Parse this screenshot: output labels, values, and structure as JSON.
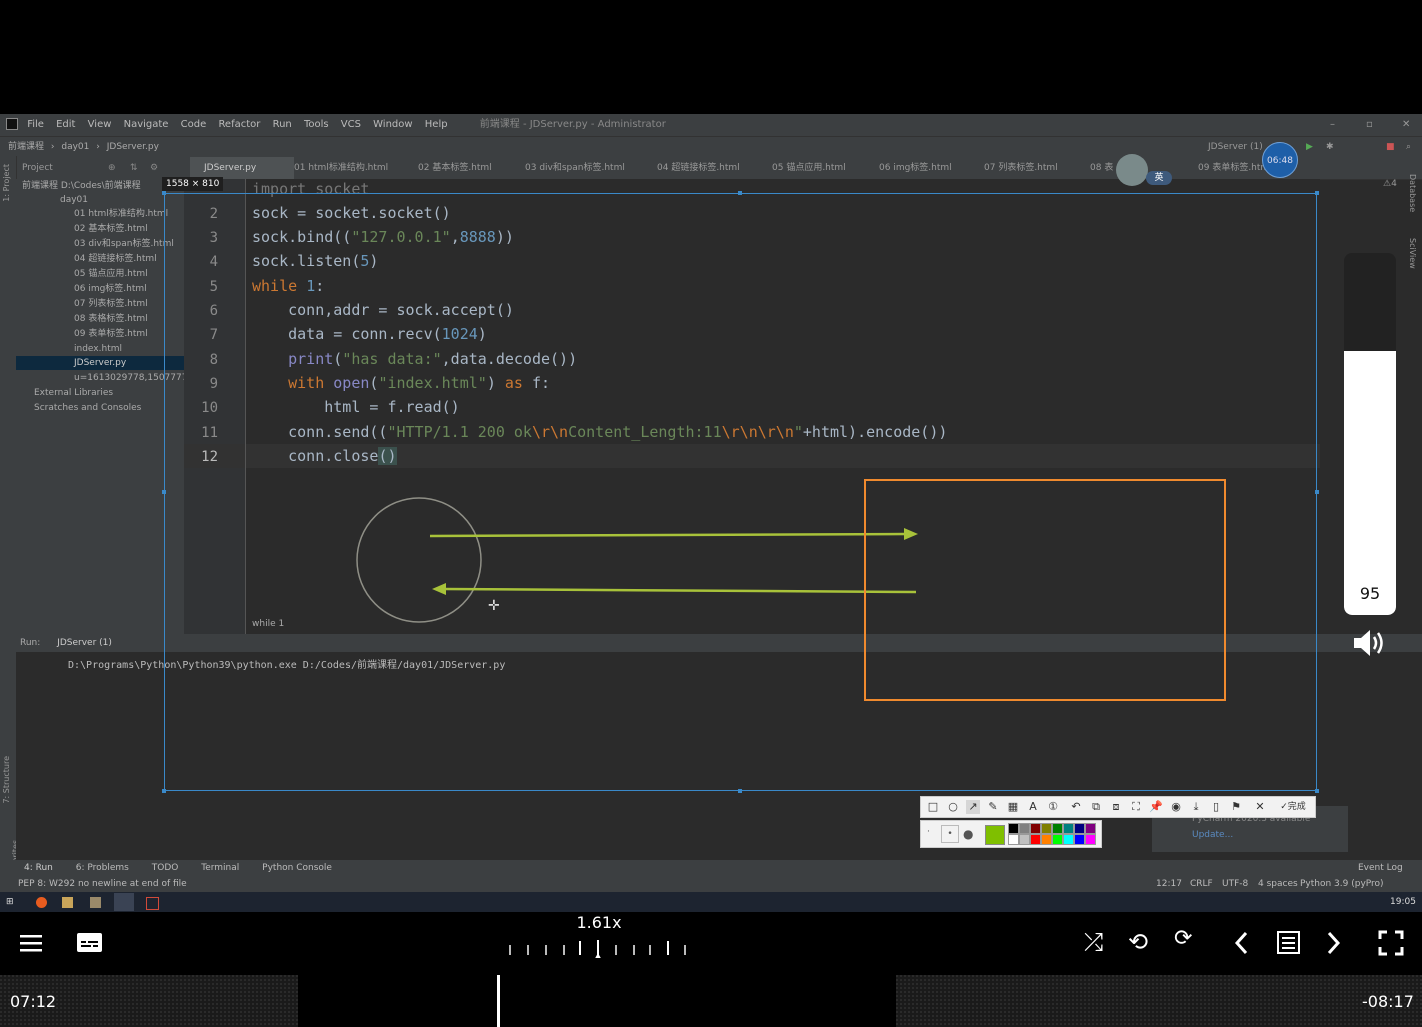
{
  "ide": {
    "menu": [
      "File",
      "Edit",
      "View",
      "Navigate",
      "Code",
      "Refactor",
      "Run",
      "Tools",
      "VCS",
      "Window",
      "Help"
    ],
    "title": "前端课程 - JDServer.py - Administrator",
    "breadcrumb": [
      "前端课程",
      "day01",
      "JDServer.py"
    ],
    "project_label": "Project",
    "tabs": [
      "JDServer.py",
      "01 html标准结构.html",
      "02 基本标签.html",
      "03 div和span标签.html",
      "04 超链接标签.html",
      "05 锚点应用.html",
      "06 img标签.html",
      "07 列表标签.html",
      "08 表",
      "09 表单标签.html"
    ],
    "run_config": "JDServer (1)",
    "tree": {
      "root": "前端课程  D:\\Codes\\前端课程",
      "folder": "day01",
      "files": [
        "01 html标准结构.html",
        "02 基本标签.html",
        "03 div和span标签.html",
        "04 超链接标签.html",
        "05 锚点应用.html",
        "06 img标签.html",
        "07 列表标签.html",
        "08 表格标签.html",
        "09 表单标签.html",
        "index.html",
        "JDServer.py",
        "u=1613029778,1507777113"
      ],
      "external": "External Libraries",
      "scratches": "Scratches and Consoles"
    },
    "code_lines": [
      {
        "n": "",
        "text": "import socket"
      },
      {
        "n": "2",
        "text": "sock = socket.socket()"
      },
      {
        "n": "3",
        "text": "sock.bind((\"127.0.0.1\",8888))"
      },
      {
        "n": "4",
        "text": "sock.listen(5)"
      },
      {
        "n": "5",
        "text": "while 1:"
      },
      {
        "n": "6",
        "text": "    conn,addr = sock.accept()"
      },
      {
        "n": "7",
        "text": "    data = conn.recv(1024)"
      },
      {
        "n": "8",
        "text": "    print(\"has data:\",data.decode())"
      },
      {
        "n": "9",
        "text": "    with open(\"index.html\") as f:"
      },
      {
        "n": "10",
        "text": "        html = f.read()"
      },
      {
        "n": "11",
        "text": "    conn.send((\"HTTP/1.1 200 ok\\r\\nContent_Length:11\\r\\n\\r\\n\"+html).encode())"
      },
      {
        "n": "12",
        "text": "    conn.close()"
      }
    ],
    "editor_breadcrumb": "while 1",
    "warning_count": "4",
    "run_label": "Run:",
    "run_tab": "JDServer (1)",
    "console_line": "D:\\Programs\\Python\\Python39\\python.exe D:/Codes/前端课程/day01/JDServer.py",
    "tool_windows": [
      "4: Run",
      "6: Problems",
      "TODO",
      "Terminal",
      "Python Console"
    ],
    "event_log": "Event Log",
    "status_msg": "PEP 8: W292 no newline at end of file",
    "status_right": [
      "12:17",
      "CRLF",
      "UTF-8",
      "4 spaces",
      "Python 3.9 (pyPro)"
    ],
    "side_left": [
      "1: Project",
      "7: Structure",
      "2: Favorites"
    ],
    "side_right": [
      "Database",
      "SciView"
    ],
    "notification": [
      "PyCharm 2020.3 available",
      "Update..."
    ],
    "clock": "19:05",
    "timer_badge": "06:48",
    "ime_badge": "英"
  },
  "screenshot_tool": {
    "size_label": "1558 × 810",
    "done_label": "完成",
    "colors": [
      "#000000",
      "#808080",
      "#800000",
      "#808000",
      "#008000",
      "#008080",
      "#000080",
      "#800080",
      "#ffffff",
      "#c0c0c0",
      "#ff0000",
      "#ff8000",
      "#00ff00",
      "#00ffff",
      "#0000ff",
      "#ff00ff"
    ],
    "current_color": "#7fbf00"
  },
  "player": {
    "speed": "1.61x",
    "volume": 95,
    "time_current": "07:12",
    "time_remaining": "-08:17",
    "progress": 0.35
  }
}
